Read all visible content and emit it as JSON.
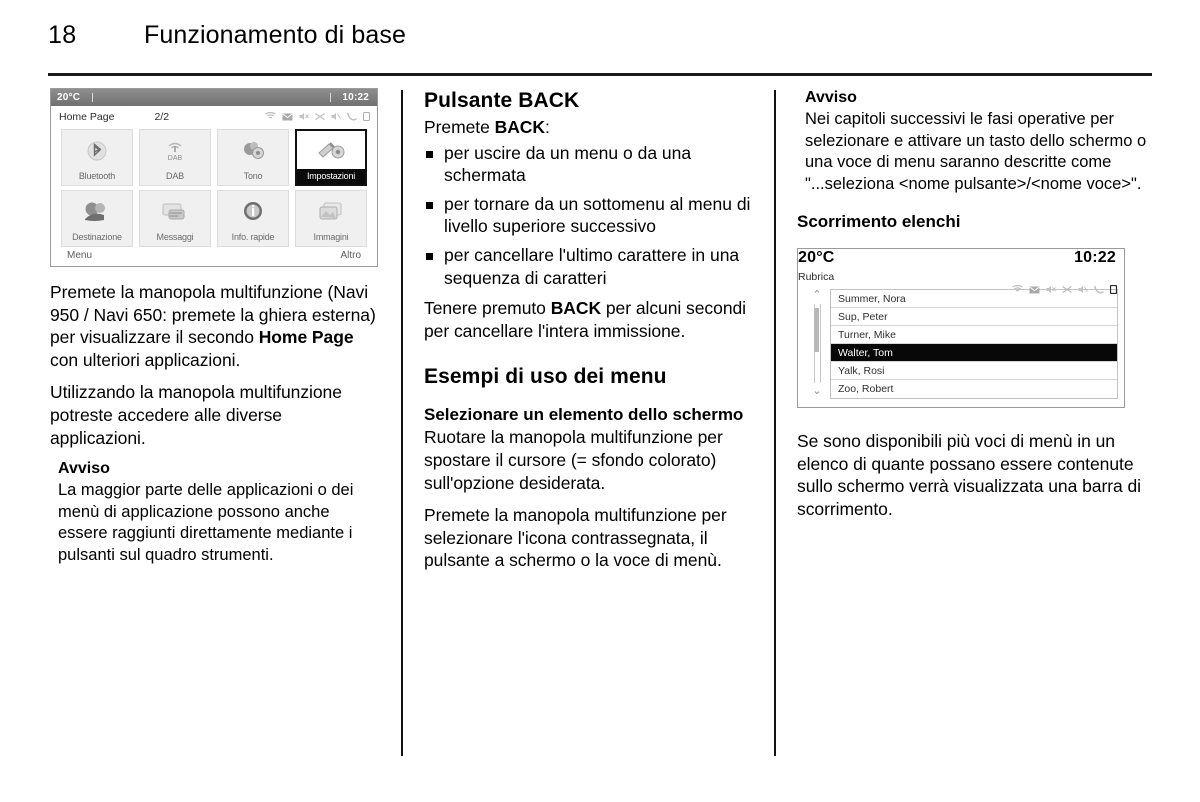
{
  "header": {
    "page_number": "18",
    "chapter_title": "Funzionamento di base"
  },
  "column1": {
    "home_screen": {
      "status_bar": {
        "temperature": "20°C",
        "clock": "10:22"
      },
      "title": "Home Page",
      "page_indicator": "2/2",
      "status_icons": [
        "wifi-icon",
        "message-icon",
        "mute-icon",
        "shuffle-icon",
        "speaker-off-icon",
        "phone-icon",
        "battery-icon"
      ],
      "tiles": [
        {
          "label": "Bluetooth",
          "icon": "bluetooth-icon",
          "selected": false
        },
        {
          "label": "DAB",
          "icon": "dab-antenna-icon",
          "selected": false
        },
        {
          "label": "Tono",
          "icon": "tone-icon",
          "selected": false
        },
        {
          "label": "Impostazioni",
          "icon": "settings-icon",
          "selected": true
        },
        {
          "label": "Destinazione",
          "icon": "destination-icon",
          "selected": false
        },
        {
          "label": "Messaggi",
          "icon": "messages-icon",
          "selected": false
        },
        {
          "label": "Info. rapide",
          "icon": "quick-info-icon",
          "selected": false
        },
        {
          "label": "Immagini",
          "icon": "images-icon",
          "selected": false
        }
      ],
      "footer_left": "Menu",
      "footer_right": "Altro"
    },
    "paragraph_1_a": "Premete la manopola multifunzione (Navi 950 / Navi 650: premete la ghiera esterna) per visualizzare il secondo ",
    "paragraph_1_bold": "Home Page",
    "paragraph_1_b": " con ulteriori applicazioni.",
    "paragraph_2": "Utilizzando la manopola multifunzione potreste accedere alle diverse applicazioni.",
    "note_title": "Avviso",
    "note_text": "La maggior parte delle applicazioni o dei menù di applicazione possono anche essere raggiunti direttamente mediante i pulsanti sul quadro strumenti."
  },
  "column2": {
    "section_title": "Pulsante BACK",
    "intro_a": "Premete ",
    "intro_bold": "BACK",
    "intro_b": ":",
    "bullets": [
      "per uscire da un menu o da una schermata",
      "per tornare da un sottomenu al menu di livello superiore successivo",
      "per cancellare l'ultimo carattere in una sequenza di caratteri"
    ],
    "hold_a": "Tenere premuto ",
    "hold_bold": "BACK",
    "hold_b": " per alcuni secondi per cancellare l'intera immissione.",
    "section_title_2": "Esempi di uso dei menu",
    "sub_title": "Selezionare un elemento dello schermo",
    "paragraph_1": "Ruotare la manopola multifunzione per spostare il cursore (= sfondo colorato) sull'opzione desiderata.",
    "paragraph_2": "Premete la manopola multifunzione per selezionare l'icona contrassegnata, il pulsante a schermo o la voce di menù."
  },
  "column3": {
    "note_title": "Avviso",
    "note_text": "Nei capitoli successivi le fasi operative per selezionare e attivare un tasto dello schermo o una voce di menu saranno descritte come \"...seleziona <nome pulsante>/<nome voce>\".",
    "sub_title": "Scorrimento elenchi",
    "phonebook_screen": {
      "status_bar": {
        "temperature": "20°C",
        "clock": "10:22"
      },
      "title": "Rubrica",
      "status_icons": [
        "wifi-icon",
        "message-icon",
        "mute-icon",
        "shuffle-icon",
        "speaker-off-icon",
        "phone-icon",
        "battery-icon"
      ],
      "contacts": [
        {
          "name": "Summer, Nora",
          "selected": false
        },
        {
          "name": "Sup, Peter",
          "selected": false
        },
        {
          "name": "Turner, Mike",
          "selected": false
        },
        {
          "name": "Walter, Tom",
          "selected": true
        },
        {
          "name": "Yalk, Rosi",
          "selected": false
        },
        {
          "name": "Zoo, Robert",
          "selected": false
        }
      ],
      "scroll_up": "⌃",
      "scroll_down": "⌄"
    },
    "paragraph_1": "Se sono disponibili più voci di menù in un elenco di quante possano essere contenute sullo schermo verrà visualizzata una barra di scorrimento."
  }
}
